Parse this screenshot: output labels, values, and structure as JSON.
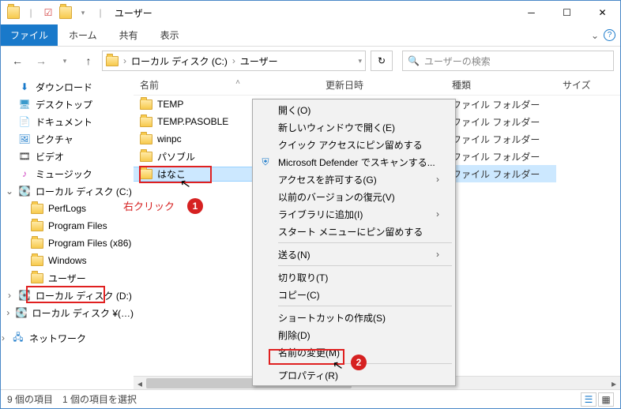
{
  "title": "ユーザー",
  "menu": {
    "file": "ファイル",
    "home": "ホーム",
    "share": "共有",
    "view": "表示"
  },
  "breadcrumb": {
    "a": "ローカル ディスク (C:)",
    "b": "ユーザー"
  },
  "search_placeholder": "ユーザーの検索",
  "columns": {
    "name": "名前",
    "date": "更新日時",
    "type": "種類",
    "size": "サイズ"
  },
  "sidebar": [
    "ダウンロード",
    "デスクトップ",
    "ドキュメント",
    "ピクチャ",
    "ビデオ",
    "ミュージック",
    "ローカル ディスク (C:)",
    "PerfLogs",
    "Program Files",
    "Program Files (x86)",
    "Windows",
    "ユーザー",
    "ローカル ディスク (D:)",
    "ローカル ディスク ¥(…)",
    "ネットワーク"
  ],
  "files": [
    {
      "name": "TEMP",
      "type": "ファイル フォルダー"
    },
    {
      "name": "TEMP.PASOBLE",
      "type": "ファイル フォルダー"
    },
    {
      "name": "winpc",
      "type": "ファイル フォルダー"
    },
    {
      "name": "パソブル",
      "type": "ファイル フォルダー"
    },
    {
      "name": "はなこ",
      "type": "ファイル フォルダー"
    }
  ],
  "context": {
    "open": "開く(O)",
    "open_new": "新しいウィンドウで開く(E)",
    "pin_quick": "クイック アクセスにピン留めする",
    "defender": "Microsoft Defender でスキャンする...",
    "grant_access": "アクセスを許可する(G)",
    "restore_prev": "以前のバージョンの復元(V)",
    "add_library": "ライブラリに追加(I)",
    "pin_start": "スタート メニューにピン留めする",
    "send_to": "送る(N)",
    "cut": "切り取り(T)",
    "copy": "コピー(C)",
    "shortcut": "ショートカットの作成(S)",
    "delete": "削除(D)",
    "rename": "名前の変更(M)",
    "properties": "プロパティ(R)"
  },
  "annotations": {
    "right_click": "右クリック",
    "badge1": "1",
    "badge2": "2"
  },
  "status": {
    "count": "9 個の項目",
    "selected": "1 個の項目を選択"
  }
}
